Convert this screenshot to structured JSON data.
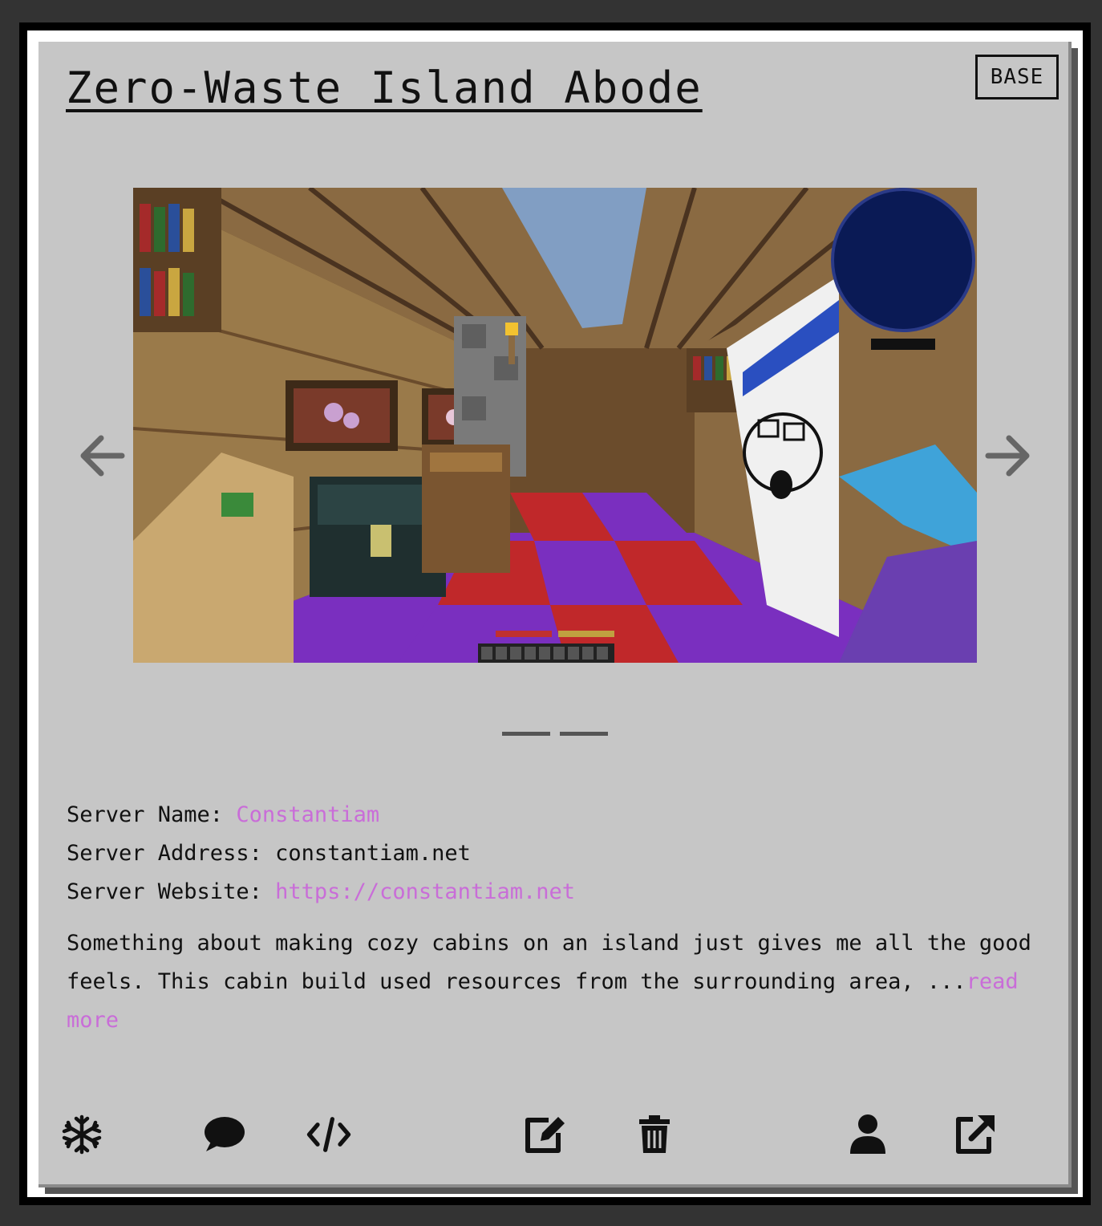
{
  "card": {
    "title": "Zero-Waste Island Abode",
    "badge": "BASE"
  },
  "carousel": {
    "image_alt": "Minecraft island cabin interior screenshot",
    "prev_icon": "arrow-left-icon",
    "next_icon": "arrow-right-icon",
    "slide_count": 2
  },
  "server": {
    "name_label": "Server Name:",
    "name_value": "Constantiam",
    "address_label": "Server Address:",
    "address_value": "constantiam.net",
    "website_label": "Server Website:",
    "website_value": "https://constantiam.net"
  },
  "description": {
    "text": "Something about making cozy cabins on an island just gives me all the good feels. This cabin build used resources from the surrounding area, ...",
    "read_more": "read more"
  },
  "actions": [
    {
      "name": "snowflake-icon"
    },
    {
      "name": "comment-icon"
    },
    {
      "name": "code-icon"
    },
    {
      "name": "edit-icon"
    },
    {
      "name": "trash-icon"
    },
    {
      "name": "user-icon"
    },
    {
      "name": "external-link-icon"
    }
  ],
  "colors": {
    "page_bg": "#333333",
    "card_bg": "#c6c6c6",
    "link": "#c96dd8",
    "text": "#111111"
  }
}
